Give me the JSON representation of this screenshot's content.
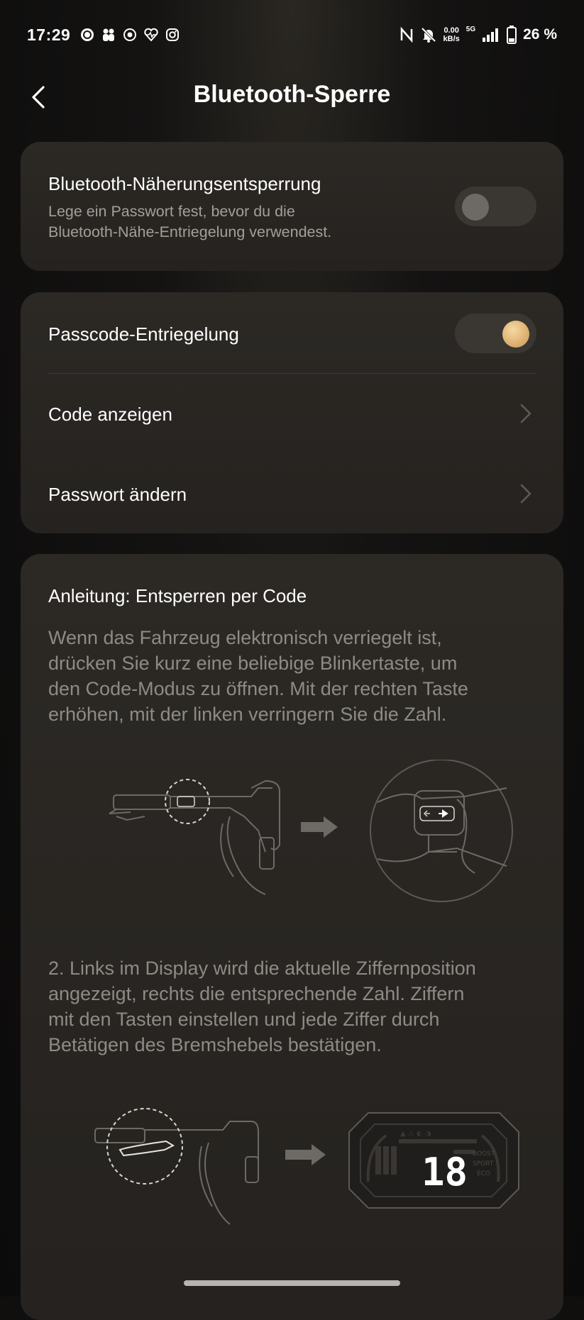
{
  "status_bar": {
    "time": "17:29",
    "speed_value": "0.00",
    "speed_unit": "kB/s",
    "network": "5G",
    "battery": "26 %"
  },
  "header": {
    "title": "Bluetooth-Sperre"
  },
  "proximity": {
    "title": "Bluetooth-Näherungsentsperrung",
    "subtitle_line1": "Lege ein Passwort fest, bevor du die",
    "subtitle_line2": "Bluetooth-Nähe-Entriegelung verwendest.",
    "enabled": false
  },
  "passcode": {
    "title": "Passcode-Entriegelung",
    "enabled": true,
    "show_code_label": "Code anzeigen",
    "change_password_label": "Passwort ändern"
  },
  "guide": {
    "title": "Anleitung: Entsperren per Code",
    "step1_lines": [
      "Wenn das Fahrzeug elektronisch verriegelt ist,",
      "drücken Sie kurz eine beliebige Blinkertaste, um",
      "den Code-Modus zu öffnen. Mit der rechten Taste",
      "erhöhen, mit der linken verringern Sie die Zahl."
    ],
    "step2_lines": [
      "2. Links im Display wird die aktuelle Ziffernposition",
      "angezeigt, rechts die entsprechende Zahl. Ziffern",
      "mit den Tasten einstellen und jede Ziffer durch",
      "Betätigen des Bremshebels bestätigen."
    ],
    "display_digits": "18",
    "display_modes": [
      "BOOST",
      "SPORT",
      "ECO"
    ]
  }
}
